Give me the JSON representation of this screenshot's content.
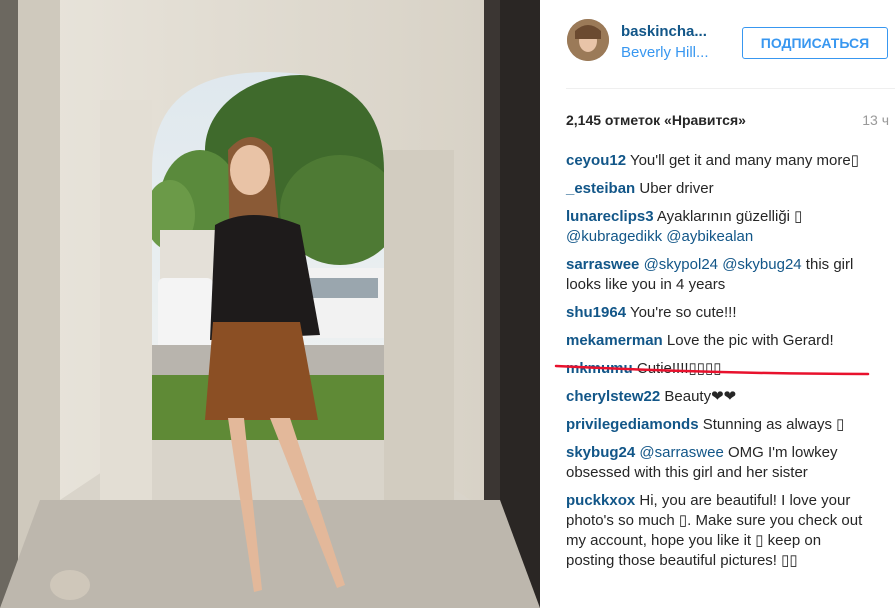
{
  "post": {
    "username": "baskincha...",
    "location": "Beverly Hill...",
    "follow_label": "ПОДПИСАТЬСЯ",
    "likes": "2,145 отметок «Нравится»",
    "time": "13 ч"
  },
  "comments": [
    {
      "user": "ceyou12",
      "text": " You'll get it and many many more▯"
    },
    {
      "user": "_esteiban",
      "text": " Uber driver"
    },
    {
      "user": "lunareclips3",
      "text": " Ayaklarının güzelliği ▯ ",
      "m1": "@kubragedikk",
      "m2": "@aybikealan"
    },
    {
      "user": "sarraswee",
      "m1": "@skypol24",
      "m2": "@skybug24",
      "text": " this girl looks like you in 4 years"
    },
    {
      "user": "shu1964",
      "text": " You're so cute!!!"
    },
    {
      "user": "mekamerman",
      "text": " Love the pic with Gerard!"
    },
    {
      "user": "mkmumu",
      "text": " Cutie!!!!▯▯▯▯"
    },
    {
      "user": "cherylstew22",
      "text": " Beauty❤❤"
    },
    {
      "user": "privilegediamonds",
      "text": " Stunning as always ▯"
    },
    {
      "user": "skybug24",
      "m1": "@sarraswee",
      "text": " OMG I'm lowkey obsessed with this girl and her sister"
    },
    {
      "user": "puckkxox",
      "text": " Hi, you are beautiful! I love your photo's so much ▯. Make sure you check out my account, hope you like it ▯ keep on posting those beautiful pictures! ▯▯"
    }
  ],
  "colors": {
    "link": "#125688",
    "accent": "#3897f0",
    "underline": "#e8112d"
  }
}
